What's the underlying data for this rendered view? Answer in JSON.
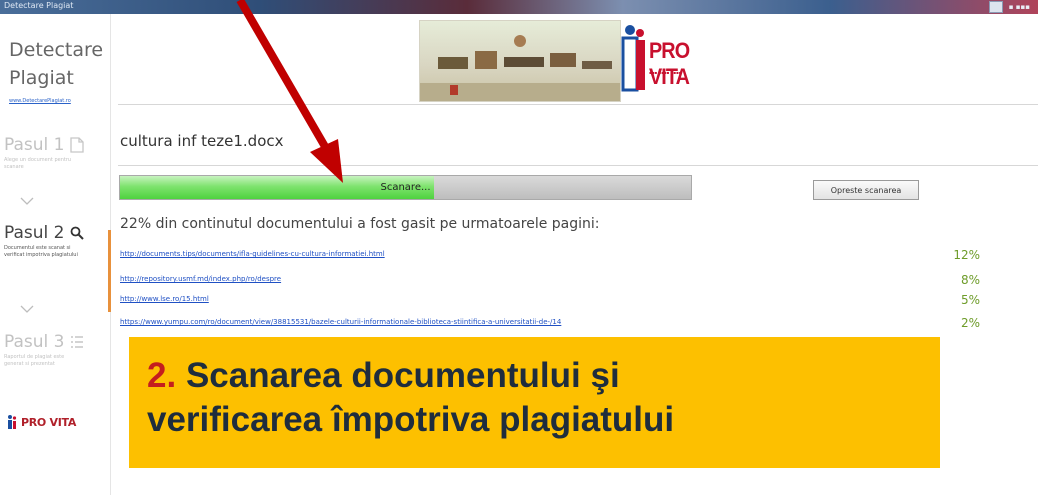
{
  "window": {
    "title": "Detectare Plagiat"
  },
  "app": {
    "title_line1": "Detectare",
    "title_line2": "Plagiat",
    "link": "www.DetectarePlagiat.ro"
  },
  "steps": [
    {
      "title": "Pasul 1",
      "description": "Alege un document pentru scanare",
      "icon": "document-icon",
      "state": "inactive"
    },
    {
      "title": "Pasul 2",
      "description": "Documentul este scanat si verificat impotriva plagiatului",
      "icon": "search-icon",
      "state": "active"
    },
    {
      "title": "Pasul 3",
      "description": "Raportul de plagiat este generat si prezentat",
      "icon": "list-icon",
      "state": "inactive"
    }
  ],
  "sidebar_logo": "PRO VITA",
  "banner": {
    "brand": "PRO VITA"
  },
  "file": {
    "name": "cultura inf teze1.docx"
  },
  "progress": {
    "label": "Scanare...",
    "value": 0.55
  },
  "stop_button": "Opreste scanarea",
  "summary": "22% din continutul documentului a fost gasit pe urmatoarele pagini:",
  "results": [
    {
      "url": "http://documents.tips/documents/ifla-guidelines-cu-cultura-informatiei.html",
      "percent": "12%"
    },
    {
      "url": "http://repository.usmf.md/index.php/ro/despre",
      "percent": "8%"
    },
    {
      "url": "http://www.lse.ro/15.html",
      "percent": "5%"
    },
    {
      "url": "https://www.yumpu.com/ro/document/view/38815531/bazele-culturii-informationale-biblioteca-stiintifica-a-universitatii-de-/14",
      "percent": "2%"
    }
  ],
  "callout": {
    "number": "2.",
    "line1": "Scanarea documentului şi",
    "line2": "verificarea împotriva plagiatului"
  },
  "colors": {
    "callout_bg": "#fdc000",
    "accent_red": "#c41e1e",
    "progress_green": "#4fd23f",
    "percent_green": "#6e9c2a",
    "link_blue": "#1f50c4",
    "arrow_red": "#c00000"
  }
}
